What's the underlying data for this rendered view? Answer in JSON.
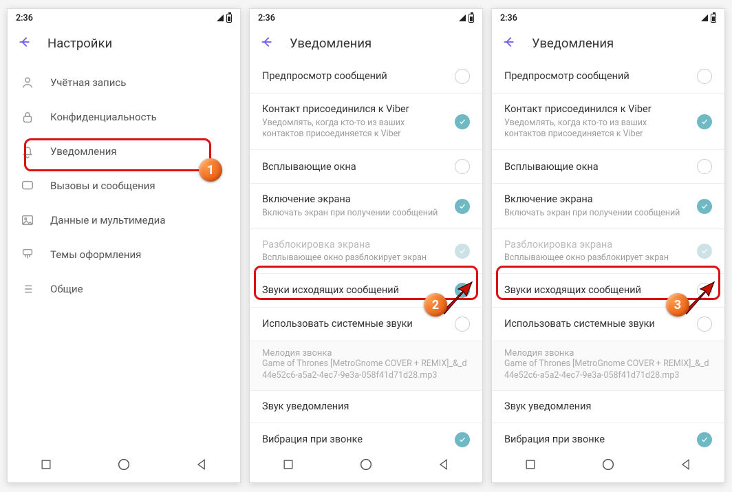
{
  "status_time": "2:36",
  "screens": {
    "settings": {
      "title": "Настройки",
      "items": [
        {
          "name": "account",
          "label": "Учётная запись"
        },
        {
          "name": "privacy",
          "label": "Конфиденциальность"
        },
        {
          "name": "notifications",
          "label": "Уведомления"
        },
        {
          "name": "calls",
          "label": "Вызовы и сообщения"
        },
        {
          "name": "media",
          "label": "Данные и мультимедиа"
        },
        {
          "name": "themes",
          "label": "Темы оформления"
        },
        {
          "name": "general",
          "label": "Общие"
        }
      ]
    },
    "notifications": {
      "title": "Уведомления",
      "items": [
        {
          "key": "preview",
          "title": "Предпросмотр сообщений",
          "subtitle": "",
          "state": "off"
        },
        {
          "key": "joined",
          "title": "Контакт присоединился к Viber",
          "subtitle": "Уведомлять, когда кто-то из ваших контактов присоединяется к Viber",
          "state": "on"
        },
        {
          "key": "popups",
          "title": "Всплывающие окна",
          "subtitle": "",
          "state": "off"
        },
        {
          "key": "screenon",
          "title": "Включение экрана",
          "subtitle": "Включать экран при получении сообщений",
          "state": "on"
        },
        {
          "key": "unlock",
          "title": "Разблокировка экрана",
          "subtitle": "Всплывающее окно разблокирует экран",
          "state": "faded",
          "disabled": true
        },
        {
          "key": "outgoing",
          "title": "Звуки исходящих сообщений",
          "subtitle": "",
          "state": "on"
        },
        {
          "key": "systemsounds",
          "title": "Использовать системные звуки",
          "subtitle": "",
          "state": "off"
        }
      ],
      "ringtone": {
        "label": "Мелодия звонка",
        "value": "Game of Thrones [MetroGnome COVER + REMIX]_&_d44e52c6-a5a2-4ec7-9e3a-058f41d71d28.mp3"
      },
      "tail": [
        {
          "key": "notif_sound",
          "title": "Звук уведомления",
          "state": "none"
        },
        {
          "key": "vibrate",
          "title": "Вибрация при звонке",
          "state": "on"
        }
      ]
    }
  },
  "screen3_outgoing_state": "off",
  "steps": {
    "1": "1",
    "2": "2",
    "3": "3"
  }
}
